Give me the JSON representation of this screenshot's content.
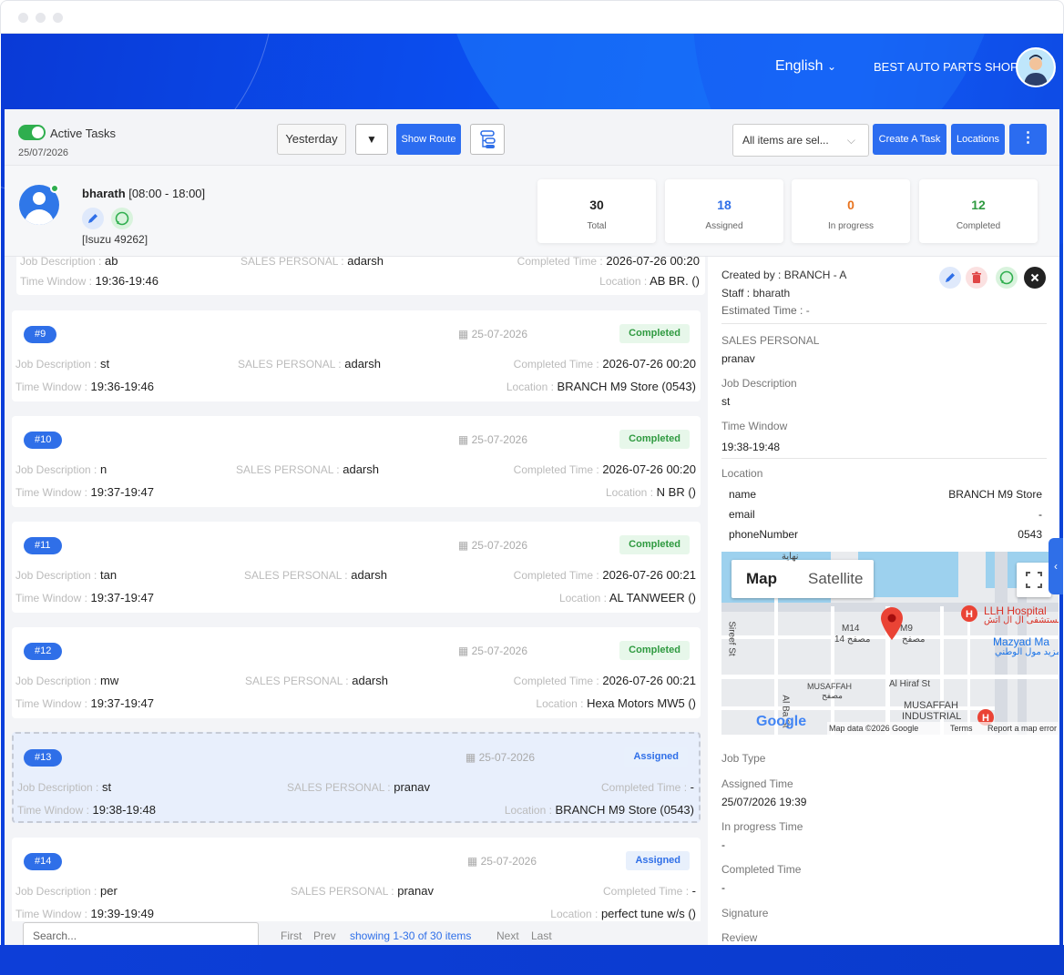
{
  "header": {
    "language": "English",
    "shop_name": "BEST AUTO PARTS SHOP"
  },
  "toolbar": {
    "active_tasks_label": "Active Tasks",
    "date": "25/07/2026",
    "yesterday_label": "Yesterday",
    "show_route_label": "Show Route",
    "items_select_value": "All items are sel...",
    "create_task_label": "Create A Task",
    "locations_label": "Locations"
  },
  "driver": {
    "name": "bharath",
    "shift": "[08:00 - 18:00]",
    "vehicle": "[Isuzu 49262]"
  },
  "stats": [
    {
      "value": "30",
      "label": "Total",
      "color": "#222222"
    },
    {
      "value": "18",
      "label": "Assigned",
      "color": "#2f6fe8"
    },
    {
      "value": "0",
      "label": "In progress",
      "color": "#e8731f"
    },
    {
      "value": "12",
      "label": "Completed",
      "color": "#2f9a40"
    }
  ],
  "tasks": [
    {
      "id": "",
      "date": "",
      "status": "",
      "job": "ab",
      "sales": "adarsh",
      "completed_time": "2026-07-26 00:20",
      "window": "19:36-19:46",
      "location": "AB BR. ()"
    },
    {
      "id": "#9",
      "date": "25-07-2026",
      "status": "Completed",
      "job": "st",
      "sales": "adarsh",
      "completed_time": "2026-07-26 00:20",
      "window": "19:36-19:46",
      "location": "BRANCH M9 Store (0543)"
    },
    {
      "id": "#10",
      "date": "25-07-2026",
      "status": "Completed",
      "job": "n",
      "sales": "adarsh",
      "completed_time": "2026-07-26 00:20",
      "window": "19:37-19:47",
      "location": "N BR ()"
    },
    {
      "id": "#11",
      "date": "25-07-2026",
      "status": "Completed",
      "job": "tan",
      "sales": "adarsh",
      "completed_time": "2026-07-26 00:21",
      "window": "19:37-19:47",
      "location": "AL TANWEER ()"
    },
    {
      "id": "#12",
      "date": "25-07-2026",
      "status": "Completed",
      "job": "mw",
      "sales": "adarsh",
      "completed_time": "2026-07-26 00:21",
      "window": "19:37-19:47",
      "location": "Hexa Motors MW5 ()"
    },
    {
      "id": "#13",
      "date": "25-07-2026",
      "status": "Assigned",
      "job": "st",
      "sales": "pranav",
      "completed_time": "-",
      "window": "19:38-19:48",
      "location": "BRANCH M9 Store (0543)"
    },
    {
      "id": "#14",
      "date": "25-07-2026",
      "status": "Assigned",
      "job": "per",
      "sales": "pranav",
      "completed_time": "-",
      "window": "19:39-19:49",
      "location": "perfect tune w/s ()"
    }
  ],
  "labels": {
    "job_description": "Job Description :",
    "sales_personal": "SALES PERSONAL :",
    "completed_time": "Completed Time :",
    "time_window": "Time Window :",
    "location": "Location :"
  },
  "pagination": {
    "search_placeholder": "Search...",
    "first": "First",
    "prev": "Prev",
    "info": "showing 1-30 of 30 items",
    "next": "Next",
    "last": "Last"
  },
  "detail": {
    "created_by": "Created by : BRANCH - A",
    "staff": "Staff : bharath",
    "estimated": "Estimated Time : -",
    "sales_label": "SALES PERSONAL",
    "sales_value": "pranav",
    "job_label": "Job Description",
    "job_value": "st",
    "window_label": "Time Window",
    "window_value": "19:38-19:48",
    "location_label": "Location",
    "loc_rows": [
      {
        "k": "name",
        "v": "BRANCH M9 Store"
      },
      {
        "k": "email",
        "v": "-"
      },
      {
        "k": "phoneNumber",
        "v": "0543"
      }
    ],
    "job_type_label": "Job Type",
    "assigned_time_label": "Assigned Time",
    "assigned_time_value": "25/07/2026 19:39",
    "inprogress_label": "In progress Time",
    "inprogress_value": "-",
    "completed_label": "Completed Time",
    "completed_value": "-",
    "signature_label": "Signature",
    "review_label": "Review"
  },
  "map": {
    "tab_map": "Map",
    "tab_satellite": "Satellite",
    "labels": [
      "M14",
      "14 مصفح",
      "M9",
      "مصفح",
      "LLH Hospital",
      "مستشفى ال ال اتش",
      "Mazyad Ma",
      "مزيد مول الوطني",
      "MUSAFFAH",
      "مصفح",
      "Al Hiraf St",
      "MUSAFFAH",
      "INDUSTRIAL",
      "Sireef St",
      "Al Ba St",
      "نهاية"
    ],
    "footer": "Map data ©2026 Google",
    "terms": "Terms",
    "report": "Report a map error",
    "google": "Google"
  }
}
